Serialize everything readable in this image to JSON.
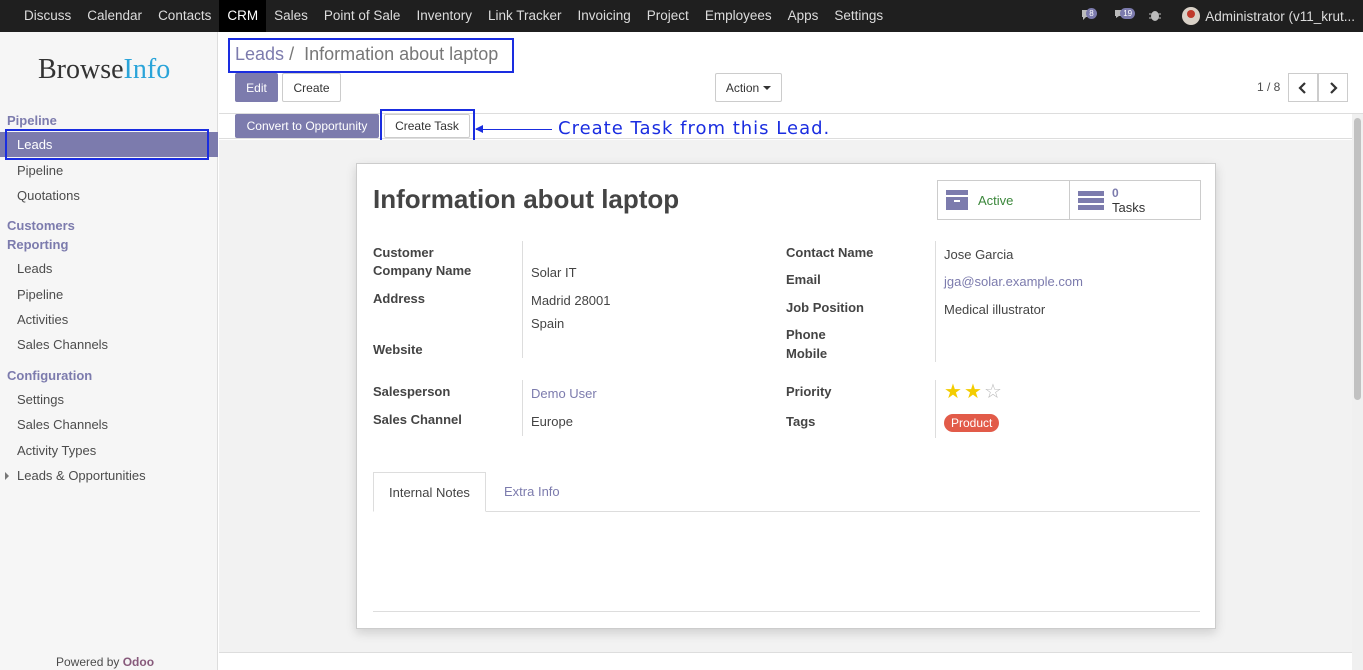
{
  "topbar": {
    "menu": [
      "Discuss",
      "Calendar",
      "Contacts",
      "CRM",
      "Sales",
      "Point of Sale",
      "Inventory",
      "Link Tracker",
      "Invoicing",
      "Project",
      "Employees",
      "Apps",
      "Settings"
    ],
    "active_menu": "CRM",
    "chat_badge": "8",
    "messages_badge": "19",
    "user": "Administrator (v11_krut..."
  },
  "sidebar": {
    "logo_dark": "Browse",
    "logo_accent": "Info",
    "sections": {
      "pipeline": "Pipeline",
      "customers": "Customers",
      "reporting": "Reporting",
      "configuration": "Configuration"
    },
    "items": {
      "leads": "Leads",
      "pipeline": "Pipeline",
      "quotations": "Quotations",
      "rep_leads": "Leads",
      "rep_pipeline": "Pipeline",
      "rep_activities": "Activities",
      "rep_channels": "Sales Channels",
      "cfg_settings": "Settings",
      "cfg_channels": "Sales Channels",
      "cfg_activity_types": "Activity Types",
      "cfg_leads_opps": "Leads & Opportunities"
    },
    "powered_by": "Powered by",
    "powered_brand": "Odoo"
  },
  "control_panel": {
    "breadcrumb_parent": "Leads",
    "breadcrumb_sep": "/",
    "breadcrumb_current": "Information about laptop",
    "edit_label": "Edit",
    "create_label": "Create",
    "action_label": "Action",
    "pager": "1 / 8"
  },
  "statusbar": {
    "convert_label": "Convert to Opportunity",
    "create_task_label": "Create Task"
  },
  "annotation": {
    "text": "Create Task from this Lead."
  },
  "form": {
    "title": "Information about laptop",
    "active_label": "Active",
    "tasks_count": "0",
    "tasks_label": "Tasks",
    "labels": {
      "customer": "Customer",
      "company_name": "Company Name",
      "address": "Address",
      "website": "Website",
      "contact_name": "Contact Name",
      "email": "Email",
      "job_position": "Job Position",
      "phone": "Phone",
      "mobile": "Mobile",
      "salesperson": "Salesperson",
      "sales_channel": "Sales Channel",
      "priority": "Priority",
      "tags": "Tags"
    },
    "values": {
      "company_name": "Solar IT",
      "address_line1": "Madrid 28001",
      "address_line2": "Spain",
      "contact_name": "Jose Garcia",
      "email": "jga@solar.example.com",
      "job_position": "Medical illustrator",
      "salesperson": "Demo User",
      "sales_channel": "Europe",
      "tag": "Product"
    },
    "priority_stars": 2,
    "priority_max": 3,
    "tabs": [
      "Internal Notes",
      "Extra Info"
    ]
  },
  "colors": {
    "accent": "#7c7bad",
    "annotation": "#1a2de0",
    "tag_bg": "#e25b49",
    "star": "#f3cc00"
  }
}
